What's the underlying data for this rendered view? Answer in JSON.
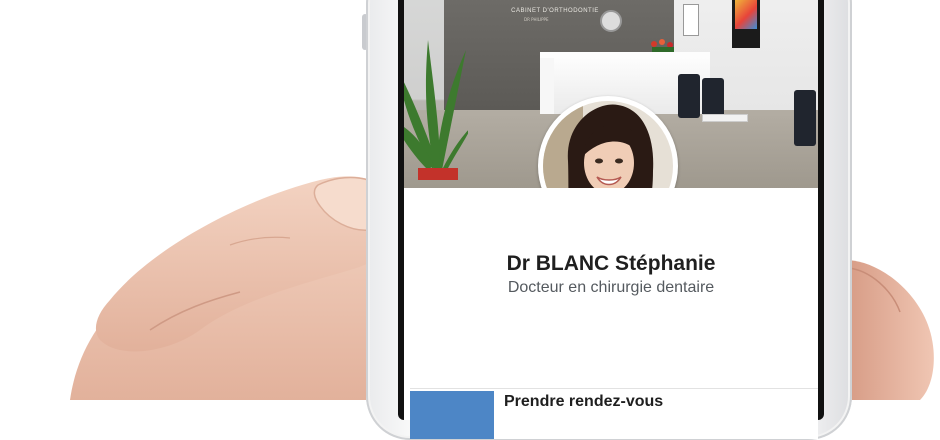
{
  "clinic": {
    "sign": "CABINET D'ORTHODONTIE",
    "sign_sub": "DR PHILIPPE"
  },
  "profile": {
    "name": "Dr BLANC Stéphanie",
    "title": "Docteur en chirurgie dentaire",
    "avatar_icon": "doctor-portrait"
  },
  "actions": {
    "appointment_label": "Prendre rendez-vous",
    "appointment_icon": "calendar-icon"
  },
  "colors": {
    "accent": "#4d86c6",
    "name_text": "#1f1f1f",
    "subtitle_text": "#555a5f"
  }
}
